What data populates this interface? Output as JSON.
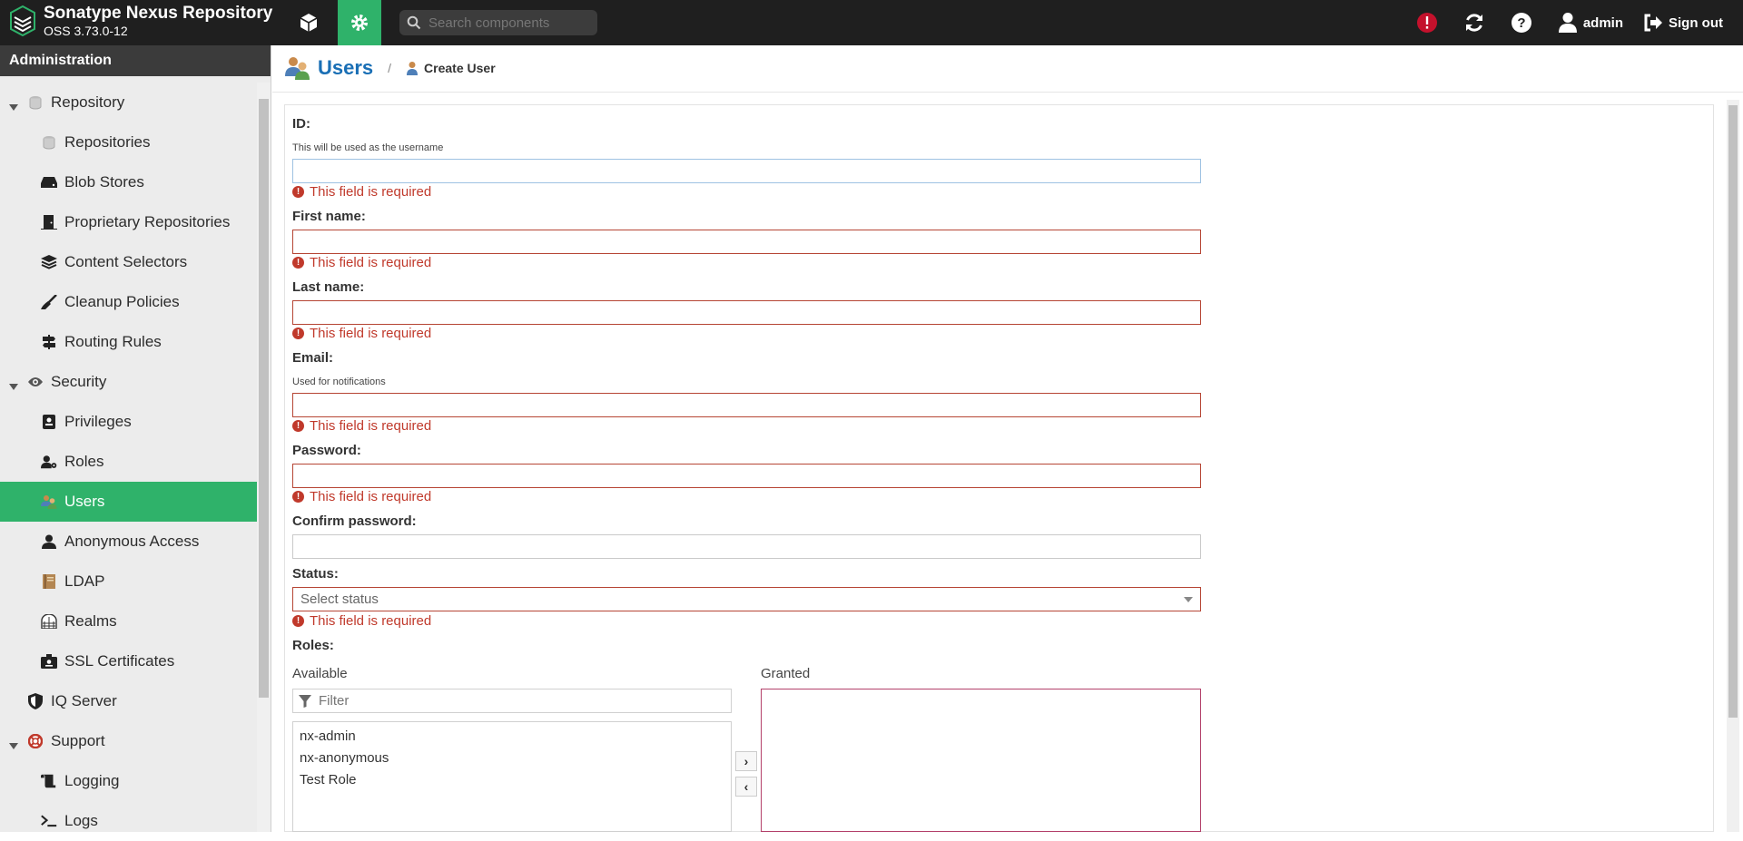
{
  "header": {
    "app_name": "Sonatype Nexus Repository",
    "version": "OSS 3.73.0-12",
    "search_placeholder": "Search components",
    "user": "admin",
    "signout_label": "Sign out"
  },
  "sidebar": {
    "heading": "Administration",
    "items": [
      {
        "label": "Repository",
        "level": 0,
        "expanded": true,
        "icon": "database-icon"
      },
      {
        "label": "Repositories",
        "level": 1,
        "icon": "database-icon"
      },
      {
        "label": "Blob Stores",
        "level": 1,
        "icon": "hard-drive-icon"
      },
      {
        "label": "Proprietary Repositories",
        "level": 1,
        "icon": "door-icon"
      },
      {
        "label": "Content Selectors",
        "level": 1,
        "icon": "layers-icon"
      },
      {
        "label": "Cleanup Policies",
        "level": 1,
        "icon": "broom-icon"
      },
      {
        "label": "Routing Rules",
        "level": 1,
        "icon": "signpost-icon"
      },
      {
        "label": "Security",
        "level": 0,
        "expanded": true,
        "icon": "eye-icon"
      },
      {
        "label": "Privileges",
        "level": 1,
        "icon": "id-badge-icon"
      },
      {
        "label": "Roles",
        "level": 1,
        "icon": "user-cog-icon"
      },
      {
        "label": "Users",
        "level": 1,
        "active": true,
        "icon": "users-icon"
      },
      {
        "label": "Anonymous Access",
        "level": 1,
        "icon": "user-icon"
      },
      {
        "label": "LDAP",
        "level": 1,
        "icon": "book-icon"
      },
      {
        "label": "Realms",
        "level": 1,
        "icon": "realms-icon"
      },
      {
        "label": "SSL Certificates",
        "level": 1,
        "icon": "certificate-icon"
      },
      {
        "label": "IQ Server",
        "level": 0,
        "icon": "shield-icon"
      },
      {
        "label": "Support",
        "level": 0,
        "expanded": true,
        "icon": "lifebuoy-icon"
      },
      {
        "label": "Logging",
        "level": 1,
        "icon": "scroll-icon"
      },
      {
        "label": "Logs",
        "level": 1,
        "icon": "terminal-icon"
      }
    ]
  },
  "breadcrumb": {
    "title": "Users",
    "separator": "/",
    "current": "Create User"
  },
  "form": {
    "id_label": "ID:",
    "id_hint": "This will be used as the username",
    "first_name_label": "First name:",
    "last_name_label": "Last name:",
    "email_label": "Email:",
    "email_hint": "Used for notifications",
    "password_label": "Password:",
    "confirm_password_label": "Confirm password:",
    "status_label": "Status:",
    "status_placeholder": "Select status",
    "roles_label": "Roles:",
    "required_error": "This field is required",
    "available_label": "Available",
    "granted_label": "Granted",
    "filter_placeholder": "Filter",
    "available_roles": [
      "nx-admin",
      "nx-anonymous",
      "Test Role"
    ]
  },
  "colors": {
    "accent": "#2fb26a",
    "error": "#c0392b",
    "header_bg": "#1f1f1f",
    "title_blue": "#1a6fb5"
  }
}
